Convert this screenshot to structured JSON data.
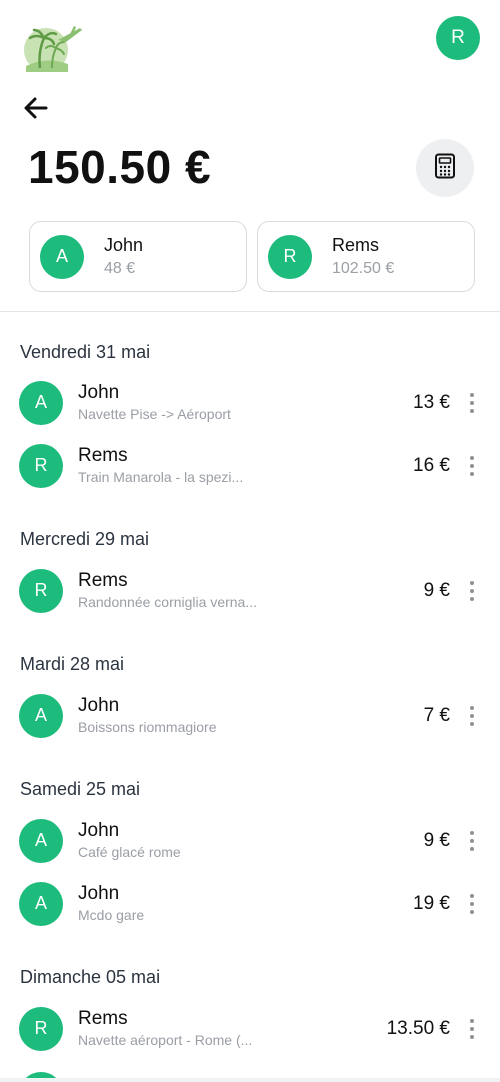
{
  "header": {
    "user_initial": "R",
    "total": "150.50 €"
  },
  "balances": [
    {
      "initial": "A",
      "name": "John",
      "amount": "48 €"
    },
    {
      "initial": "R",
      "name": "Rems",
      "amount": "102.50 €"
    }
  ],
  "groups": [
    {
      "date": "Vendredi 31 mai",
      "expenses": [
        {
          "initial": "A",
          "name": "John",
          "desc": "Navette Pise -> Aéroport",
          "amount": "13 €"
        },
        {
          "initial": "R",
          "name": "Rems",
          "desc": "Train Manarola - la spezi...",
          "amount": "16 €"
        }
      ]
    },
    {
      "date": "Mercredi 29 mai",
      "expenses": [
        {
          "initial": "R",
          "name": "Rems",
          "desc": "Randonnée corniglia verna...",
          "amount": "9 €"
        }
      ]
    },
    {
      "date": "Mardi 28 mai",
      "expenses": [
        {
          "initial": "A",
          "name": "John",
          "desc": "Boissons riommagiore",
          "amount": "7 €"
        }
      ]
    },
    {
      "date": "Samedi 25 mai",
      "expenses": [
        {
          "initial": "A",
          "name": "John",
          "desc": "Café glacé rome",
          "amount": "9 €"
        },
        {
          "initial": "A",
          "name": "John",
          "desc": "Mcdo gare",
          "amount": "19 €"
        }
      ]
    },
    {
      "date": "Dimanche 05 mai",
      "expenses": [
        {
          "initial": "R",
          "name": "Rems",
          "desc": "Navette aéroport - Rome (...",
          "amount": "13.50 €"
        }
      ]
    }
  ],
  "icons": {
    "logo": "palm-tree-plane-logo",
    "back": "arrow-left-icon",
    "calculator": "calculator-icon",
    "more": "kebab-menu-icon"
  },
  "colors": {
    "accent": "#1dbb7c",
    "muted_text": "#9a9ea5",
    "card_border": "#d9dbdf",
    "button_bg": "#eeeff1"
  }
}
